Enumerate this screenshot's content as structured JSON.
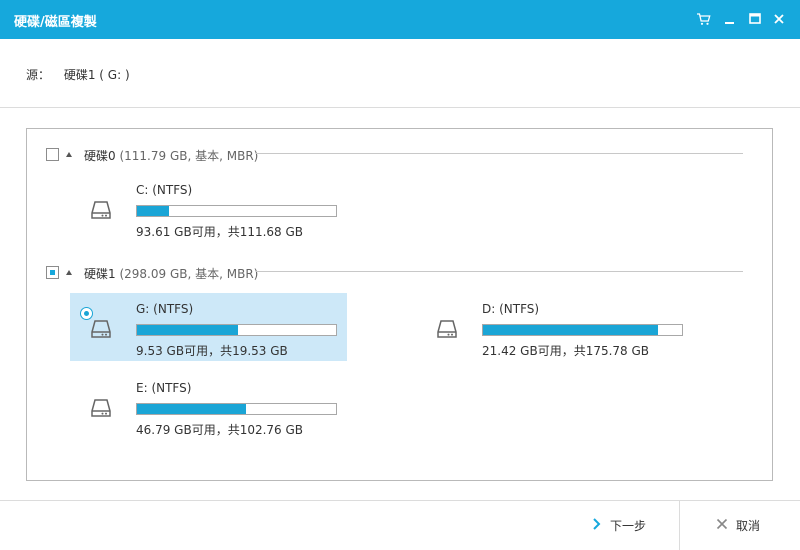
{
  "window": {
    "title": "硬碟/磁區複製",
    "controls": [
      "cart-icon",
      "minimize-icon",
      "maximize-icon",
      "close-icon"
    ]
  },
  "source": {
    "label": "源：",
    "value": "硬碟1 ( G: )"
  },
  "disks": [
    {
      "name": "硬碟0",
      "detail": "(111.79 GB, 基本, MBR)",
      "checked": "unchecked",
      "partitions": [
        {
          "name": "C: (NTFS)",
          "free_text": "93.61 GB可用，共111.68 GB",
          "used_fraction": 0.16,
          "selected": false
        }
      ]
    },
    {
      "name": "硬碟1",
      "detail": "(298.09 GB, 基本, MBR)",
      "checked": "partial",
      "partitions": [
        {
          "name": "G: (NTFS)",
          "free_text": "9.53 GB可用，共19.53 GB",
          "used_fraction": 0.51,
          "selected": true
        },
        {
          "name": "D: (NTFS)",
          "free_text": "21.42 GB可用，共175.78 GB",
          "used_fraction": 0.88,
          "selected": false
        },
        {
          "name": "E: (NTFS)",
          "free_text": "46.79 GB可用，共102.76 GB",
          "used_fraction": 0.55,
          "selected": false
        }
      ]
    }
  ],
  "footer": {
    "next_label": "下一步",
    "cancel_label": "取消"
  },
  "colors": {
    "accent": "#16a8dc",
    "bar_fill": "#1aa5d6",
    "selected_bg": "#cde8f8"
  }
}
